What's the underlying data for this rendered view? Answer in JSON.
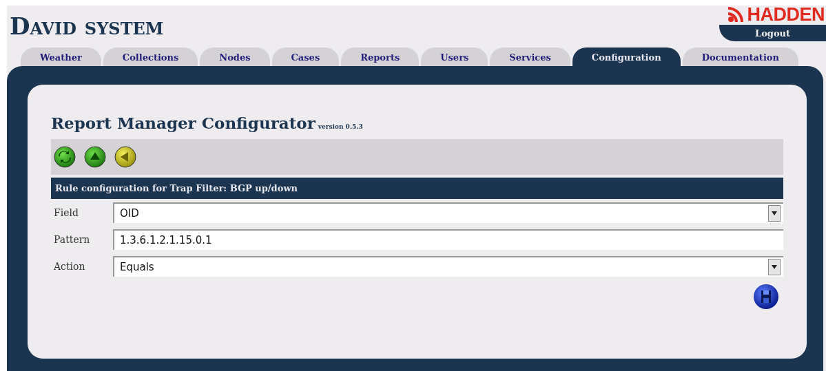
{
  "header": {
    "title": "David system",
    "logo": "HADDEN",
    "logout": "Logout"
  },
  "tabs": [
    {
      "label": "Weather",
      "selected": false
    },
    {
      "label": "Collections",
      "selected": false
    },
    {
      "label": "Nodes",
      "selected": false
    },
    {
      "label": "Cases",
      "selected": false
    },
    {
      "label": "Reports",
      "selected": false
    },
    {
      "label": "Users",
      "selected": false
    },
    {
      "label": "Services",
      "selected": false
    },
    {
      "label": "Configuration",
      "selected": true
    },
    {
      "label": "Documentation",
      "selected": false
    }
  ],
  "page": {
    "title": "Report Manager Configurator",
    "version": "version 0.5.3"
  },
  "toolbar": [
    {
      "kind": "refresh"
    },
    {
      "kind": "up"
    },
    {
      "kind": "back"
    }
  ],
  "section": {
    "title": "Rule configuration for Trap Filter: BGP up/down"
  },
  "fields": [
    {
      "label": "Field",
      "kind": "select",
      "value": "OID"
    },
    {
      "label": "Pattern",
      "kind": "text",
      "value": "1.3.6.1.2.1.15.0.1"
    },
    {
      "label": "Action",
      "kind": "select",
      "value": "Equals"
    }
  ]
}
